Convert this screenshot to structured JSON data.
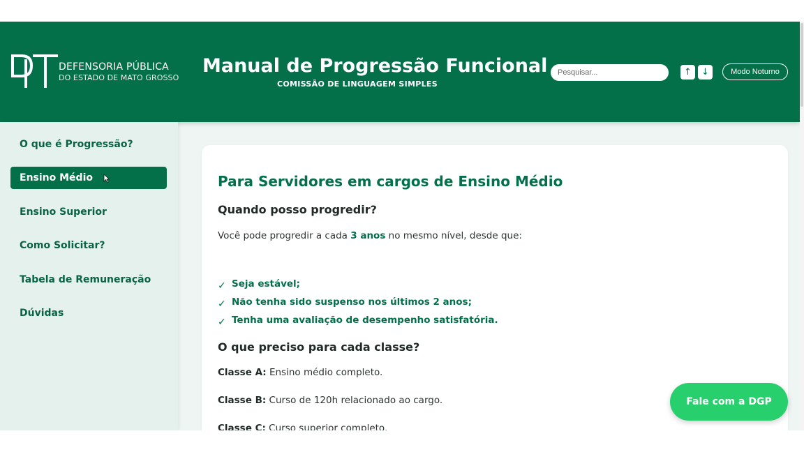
{
  "header": {
    "brand_line1": "DEFENSORIA PÚBLICA",
    "brand_line2": "DO ESTADO DE MATO GROSSO",
    "title": "Manual de Progressão Funcional",
    "subtitle": "COMISSÃO DE LINGUAGEM SIMPLES",
    "search_placeholder": "Pesquisar...",
    "up_button": "↑",
    "down_button": "↓",
    "night_mode_button": "Modo Noturno"
  },
  "sidebar": {
    "items": [
      {
        "label": "O que é Progressão?"
      },
      {
        "label": "Ensino Médio",
        "active": true
      },
      {
        "label": "Ensino Superior"
      },
      {
        "label": "Como Solicitar?"
      },
      {
        "label": "Tabela de Remuneração"
      },
      {
        "label": "Dúvidas"
      }
    ]
  },
  "content": {
    "heading": "Para Servidores em cargos de Ensino Médio",
    "section1_title": "Quando posso progredir?",
    "intro_before": "Você pode progredir a cada ",
    "intro_highlight": "3 anos",
    "intro_after": " no mesmo nível, desde que:",
    "check_mark": "✓",
    "conditions": [
      "Seja estável;",
      "Não tenha sido suspenso nos últimos 2 anos;",
      "Tenha uma avaliação de desempenho satisfatória."
    ],
    "section2_title": "O que preciso para cada classe?",
    "classes": [
      {
        "label": "Classe A:",
        "text": " Ensino médio completo."
      },
      {
        "label": "Classe B:",
        "text": " Curso de 120h relacionado ao cargo."
      },
      {
        "label": "Classe C:",
        "text": " Curso superior completo."
      }
    ]
  },
  "fab_label": "Fale com a DGP",
  "colors": {
    "brand_green": "#04704a",
    "sidebar_bg": "#e4f1ed",
    "fab_green": "#27cf6d"
  }
}
